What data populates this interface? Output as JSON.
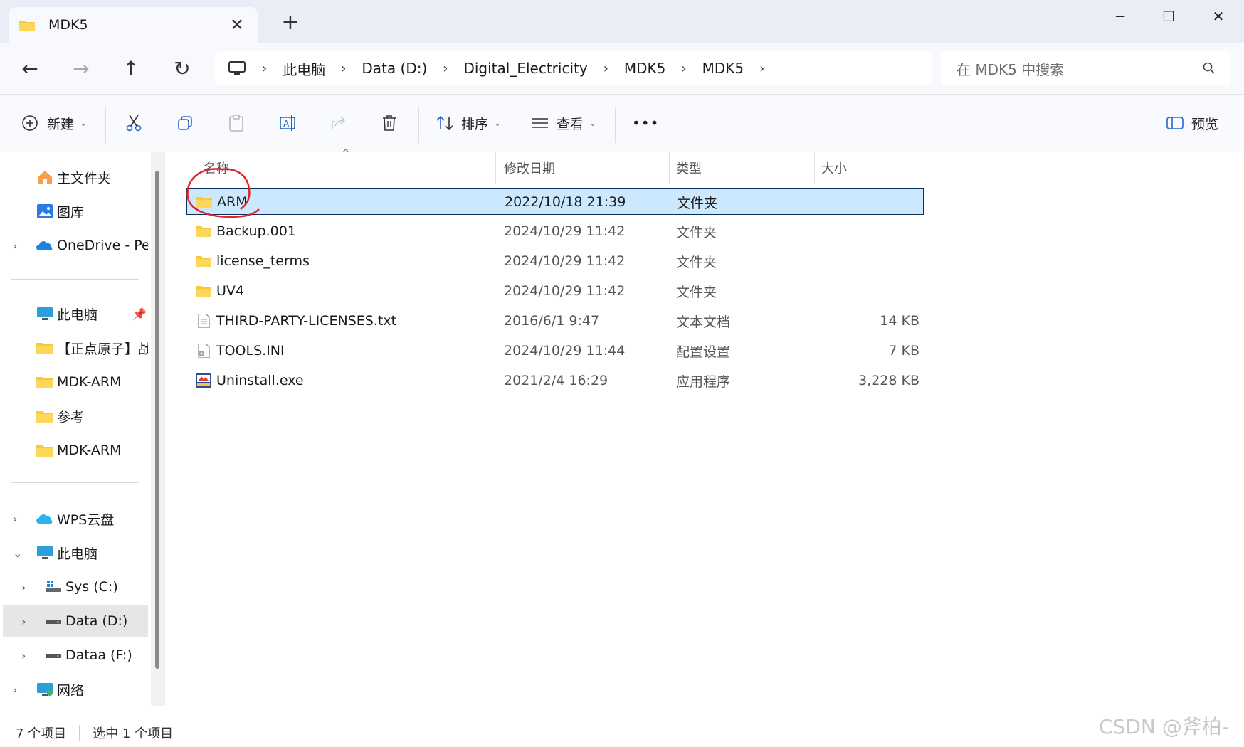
{
  "window": {
    "tab_title": "MDK5",
    "tab_close": "✕",
    "new_tab": "+",
    "minimize": "─",
    "maximize": "☐",
    "close": "✕"
  },
  "nav": {
    "back": "←",
    "forward": "→",
    "up": "↑",
    "refresh": "↻"
  },
  "address": {
    "segments": [
      "此电脑",
      "Data (D:)",
      "Digital_Electricity",
      "MDK5",
      "MDK5"
    ],
    "chevron": "›"
  },
  "search": {
    "placeholder": "在 MDK5 中搜索"
  },
  "toolbar": {
    "new_label": "新建",
    "sort_label": "排序",
    "view_label": "查看",
    "more_label": "•••",
    "preview_label": "预览"
  },
  "sidebar": {
    "items": [
      {
        "label": "主文件夹",
        "icon": "home-icon"
      },
      {
        "label": "图库",
        "icon": "gallery-icon"
      },
      {
        "label": "OneDrive - Per",
        "icon": "onedrive-icon"
      },
      {
        "label": "此电脑",
        "icon": "computer-icon"
      },
      {
        "label": "【正点原子】战",
        "icon": "folder-icon"
      },
      {
        "label": "MDK-ARM",
        "icon": "folder-icon"
      },
      {
        "label": "参考",
        "icon": "folder-icon"
      },
      {
        "label": "MDK-ARM",
        "icon": "folder-icon"
      },
      {
        "label": "WPS云盘",
        "icon": "cloud-icon"
      },
      {
        "label": "此电脑",
        "icon": "computer-icon"
      },
      {
        "label": "Sys (C:)",
        "icon": "windows-drive-icon"
      },
      {
        "label": "Data (D:)",
        "icon": "drive-icon"
      },
      {
        "label": "Dataa (F:)",
        "icon": "drive-icon"
      },
      {
        "label": "网络",
        "icon": "network-icon"
      }
    ]
  },
  "columns": {
    "name": "名称",
    "modified": "修改日期",
    "type": "类型",
    "size": "大小"
  },
  "files": [
    {
      "name": "ARM",
      "modified": "2022/10/18 21:39",
      "type": "文件夹",
      "size": "",
      "icon": "folder-icon",
      "selected": true
    },
    {
      "name": "Backup.001",
      "modified": "2024/10/29 11:42",
      "type": "文件夹",
      "size": "",
      "icon": "folder-icon"
    },
    {
      "name": "license_terms",
      "modified": "2024/10/29 11:42",
      "type": "文件夹",
      "size": "",
      "icon": "folder-icon"
    },
    {
      "name": "UV4",
      "modified": "2024/10/29 11:42",
      "type": "文件夹",
      "size": "",
      "icon": "folder-icon"
    },
    {
      "name": "THIRD-PARTY-LICENSES.txt",
      "modified": "2016/6/1 9:47",
      "type": "文本文档",
      "size": "14 KB",
      "icon": "text-file-icon"
    },
    {
      "name": "TOOLS.INI",
      "modified": "2024/10/29 11:44",
      "type": "配置设置",
      "size": "7 KB",
      "icon": "config-file-icon"
    },
    {
      "name": "Uninstall.exe",
      "modified": "2021/2/4 16:29",
      "type": "应用程序",
      "size": "3,228 KB",
      "icon": "exe-icon"
    }
  ],
  "status": {
    "count": "7 个项目",
    "selected": "选中 1 个项目"
  },
  "watermark": "CSDN @斧柏-",
  "colors": {
    "selection": "#cce8ff",
    "folder": "#f8c93e",
    "accent": "#0067c0",
    "annotation": "#e0242a"
  }
}
